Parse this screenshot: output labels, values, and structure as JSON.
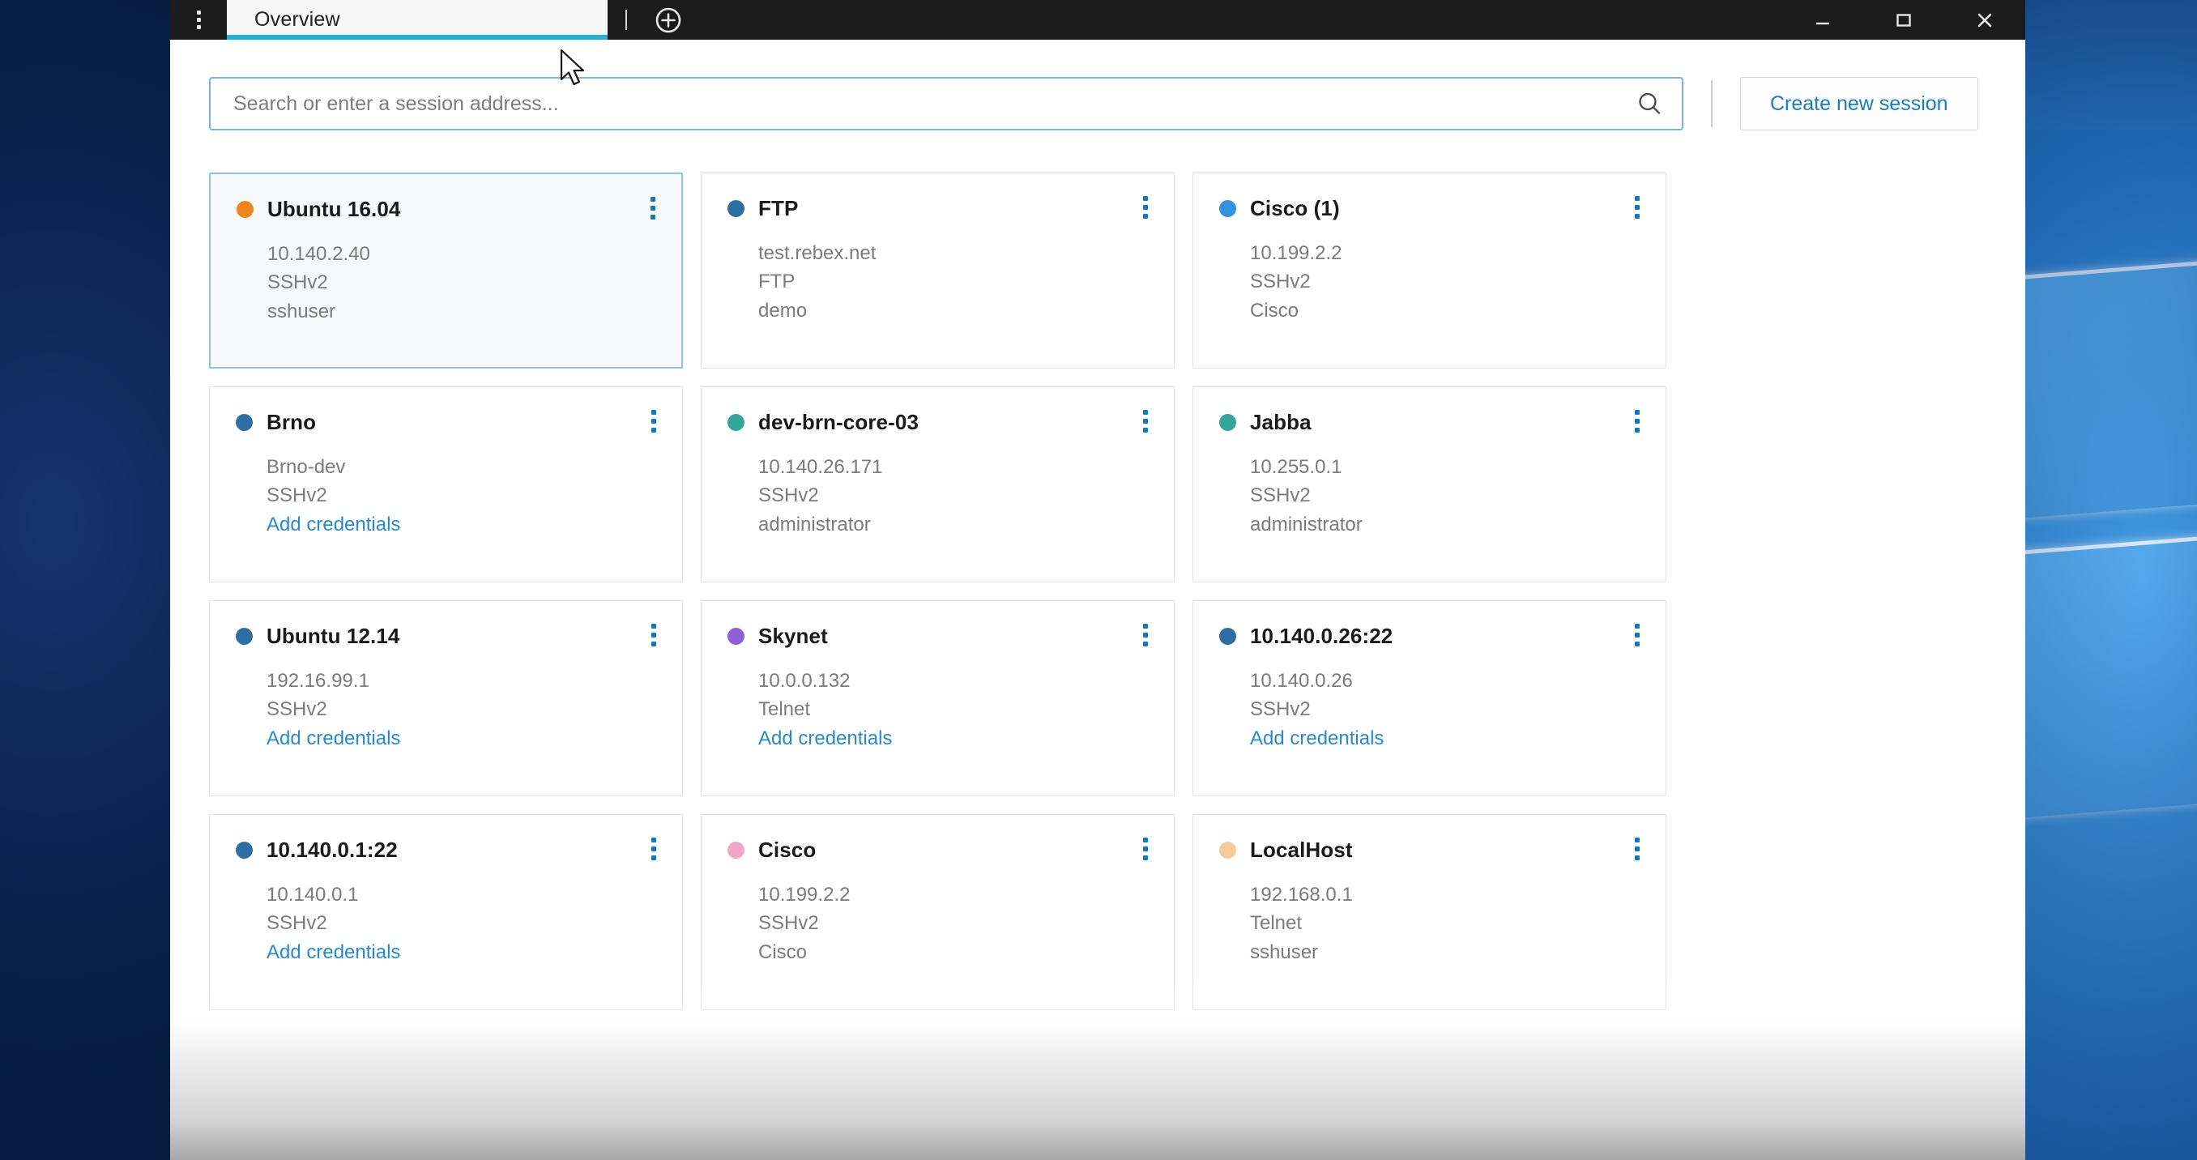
{
  "window": {
    "app_menu_icon": "kebab-menu-icon",
    "new_tab_icon": "plus-circle-icon",
    "minimize_label": "Minimize",
    "maximize_label": "Maximize",
    "close_label": "Close",
    "accent_color": "#24b0d4"
  },
  "tabs": [
    {
      "label": "Overview",
      "active": true
    }
  ],
  "search": {
    "placeholder": "Search or enter a session address...",
    "value": "",
    "icon": "search-icon"
  },
  "toolbar": {
    "create_session_label": "Create new session",
    "create_session_color": "#1f7ac0"
  },
  "sessions": [
    {
      "name": "Ubuntu 16.04",
      "host": "10.140.2.40",
      "protocol": "SSHv2",
      "credential": "sshuser",
      "credential_is_link": false,
      "dot_color": "#ef8521",
      "selected": true
    },
    {
      "name": "FTP",
      "host": "test.rebex.net",
      "protocol": "FTP",
      "credential": "demo",
      "credential_is_link": false,
      "dot_color": "#2f6ea5",
      "selected": false
    },
    {
      "name": "Cisco (1)",
      "host": "10.199.2.2",
      "protocol": "SSHv2",
      "credential": "Cisco",
      "credential_is_link": false,
      "dot_color": "#3391e0",
      "selected": false
    },
    {
      "name": "Brno",
      "host": "Brno-dev",
      "protocol": "SSHv2",
      "credential": "Add credentials",
      "credential_is_link": true,
      "dot_color": "#2f6ea5",
      "selected": false
    },
    {
      "name": "dev-brn-core-03",
      "host": "10.140.26.171",
      "protocol": "SSHv2",
      "credential": "administrator",
      "credential_is_link": false,
      "dot_color": "#35a59c",
      "selected": false
    },
    {
      "name": "Jabba",
      "host": "10.255.0.1",
      "protocol": "SSHv2",
      "credential": "administrator",
      "credential_is_link": false,
      "dot_color": "#35a59c",
      "selected": false
    },
    {
      "name": "Ubuntu 12.14",
      "host": "192.16.99.1",
      "protocol": "SSHv2",
      "credential": "Add credentials",
      "credential_is_link": true,
      "dot_color": "#2f6ea5",
      "selected": false
    },
    {
      "name": "Skynet",
      "host": "10.0.0.132",
      "protocol": "Telnet",
      "credential": "Add credentials",
      "credential_is_link": true,
      "dot_color": "#9061d6",
      "selected": false
    },
    {
      "name": "10.140.0.26:22",
      "host": "10.140.0.26",
      "protocol": "SSHv2",
      "credential": "Add credentials",
      "credential_is_link": true,
      "dot_color": "#2f6ea5",
      "selected": false
    },
    {
      "name": "10.140.0.1:22",
      "host": "10.140.0.1",
      "protocol": "SSHv2",
      "credential": "Add credentials",
      "credential_is_link": true,
      "dot_color": "#2f6ea5",
      "selected": false
    },
    {
      "name": "Cisco",
      "host": "10.199.2.2",
      "protocol": "SSHv2",
      "credential": "Cisco",
      "credential_is_link": false,
      "dot_color": "#f0a8c8",
      "selected": false
    },
    {
      "name": "LocalHost",
      "host": "192.168.0.1",
      "protocol": "Telnet",
      "credential": "sshuser",
      "credential_is_link": false,
      "dot_color": "#f6ca9a",
      "selected": false
    }
  ]
}
